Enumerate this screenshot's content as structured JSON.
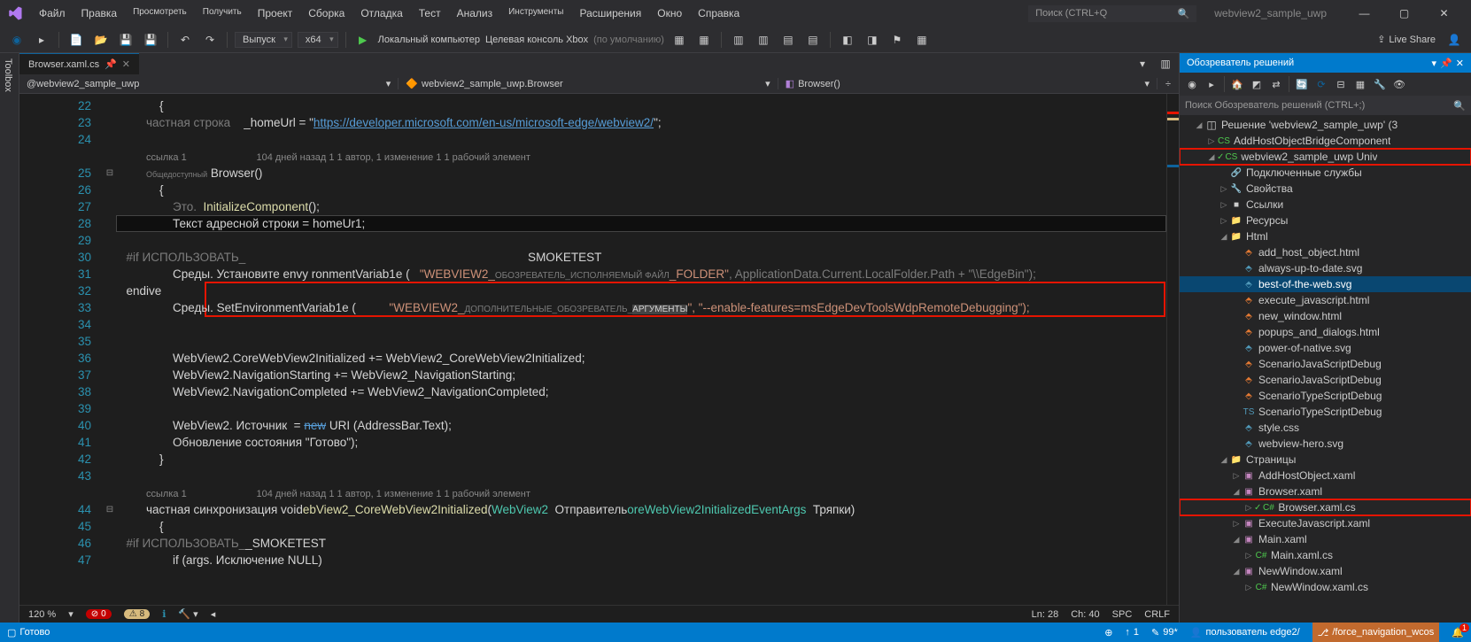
{
  "menu": [
    "Файл",
    "Правка",
    "Просмотреть",
    "Получить",
    "Проект",
    "Сборка",
    "Отладка",
    "Тест",
    "Анализ",
    "Инструменты",
    "Расширения",
    "Окно",
    "Справка"
  ],
  "menu_small_idx": [
    2,
    3,
    9
  ],
  "search_placeholder": "Поиск (CTRL+Q",
  "app_title": "webview2_sample_uwp",
  "toolbar": {
    "config": "Выпуск",
    "platform": "x64",
    "start_label": "Локальный компьютер",
    "target": "Целевая консоль Xbox",
    "target_mode": "(по умолчанию)",
    "live_share": "Live Share"
  },
  "tab": {
    "label": "Browser.xaml.cs"
  },
  "nav": {
    "scope": "@webview2_sample_uwp",
    "class": "webview2_sample_uwp.Browser",
    "member": "Browser()"
  },
  "editor_footer": {
    "zoom": "120 %",
    "errors": "0",
    "warnings": "8",
    "ln_label": "Ln:",
    "ln": "28",
    "ch_label": "Ch:",
    "ch": "40",
    "spc": "SPC",
    "crlf": "CRLF"
  },
  "codelens1": {
    "refs": "ссылка 1",
    "meta": "104 дней назад 1 1 автор, 1 изменение 1 1 рабочий элемент"
  },
  "codelens2": {
    "refs": "ссылка 1",
    "meta": "104 дней назад 1 1 автор, 1 изменение 1 1 рабочий элемент"
  },
  "lines": {
    "22": "{",
    "23_pre": "частная строка",
    "23_post": "\";",
    "23_var": "_homeUrl = \"",
    "23_url": "https://developer.microsoft.com/en-us/microsoft-edge/webview2/",
    "25_mod": "Общедоступный",
    "25_name": "Browser()",
    "26": "{",
    "27_a": "Это.",
    "27_b": "InitializeComponent",
    "27_c": "();",
    "28": "Текст адресной строки = homeUr1;",
    "30_pre": "#if",
    "30_a": "ИСПОЛЬЗОВАТЬ_",
    "30_right": "SMOKETEST",
    "31_a": "Среды. Установите envy ronmentVariab1e (",
    "31_s1": "\"WEBVIEW2_",
    "31_s1b": "ОБОЗРЕВАТЕЛЬ_ИСПОЛНЯЕМЫЙ ФАЙЛ",
    "31_s1c": "_FOLDER\"",
    "31_dim": ", ApplicationData.Current.LocalFolder.Path + \"\\\\EdgeBin\");",
    "32": "endive",
    "33_a": "Среды. SetEnvironmentVariab1e (",
    "33_s1": "\"WEBVIEW2_",
    "33_s1b": "ДОПОЛНИТЕЛЬНЫЕ_",
    "33_s1c": "ОБОЗРЕВАТЕЛЬ_",
    "33_arg": "АРГУМЕНТЫ",
    "33_s2": "\", \"--enable-features=msEdgeDevToolsWdpRemoteDebugging\");",
    "36": "WebView2.CoreWebView2Initialized += WebView2_CoreWebView2Initialized;",
    "37": "WebView2.NavigationStarting += WebView2_NavigationStarting;",
    "38": "WebView2.NavigationCompleted += WebView2_NavigationCompleted;",
    "40_a": "WebView2. Источник  = ",
    "40_new": "new",
    "40_b": " URI (AddressBar.Text);",
    "41": "Обновление состояния \"Готово\");",
    "42": "}",
    "44_a": "частная синхронизация void",
    "44_b": "ebView2_CoreWebView2Initialized",
    "44_c": "(",
    "44_t1": "WebView2",
    "44_d": "Отправитель",
    "44_t2": "oreWebView2InitializedEventArgs",
    "44_e": "Тряпки)",
    "46_pre": "#if",
    "46_a": "ИСПОЛЬЗОВАТЬ_",
    "46_b": "_SMOKETEST",
    "47": "if (args. Исключение NULL)"
  },
  "solution": {
    "title": "Обозреватель решений",
    "search_placeholder": "Поиск Обозреватель решений (CTRL+;)",
    "root": "Решение 'webview2_sample_uwp' (3",
    "items": [
      {
        "depth": 2,
        "exp": "▷",
        "ico": "CS",
        "cls": "cs-ico",
        "lbl": "AddHostObjectBridgeComponent"
      },
      {
        "depth": 2,
        "exp": "◢",
        "ico": "CS",
        "cls": "cs-ico",
        "lbl": "webview2_sample_uwp Univ",
        "hl": true,
        "check": true
      },
      {
        "depth": 3,
        "exp": "",
        "ico": "🔗",
        "cls": "",
        "lbl": "Подключенные службы"
      },
      {
        "depth": 3,
        "exp": "▷",
        "ico": "🔧",
        "cls": "",
        "lbl": "Свойства"
      },
      {
        "depth": 3,
        "exp": "▷",
        "ico": "■",
        "cls": "",
        "lbl": "Ссылки"
      },
      {
        "depth": 3,
        "exp": "▷",
        "ico": "📁",
        "cls": "fold-ico",
        "lbl": "Ресурсы"
      },
      {
        "depth": 3,
        "exp": "◢",
        "ico": "📁",
        "cls": "fold-ico",
        "lbl": "Html"
      },
      {
        "depth": 4,
        "exp": "",
        "ico": "⬘",
        "cls": "html-ico",
        "lbl": "add_host_object.html"
      },
      {
        "depth": 4,
        "exp": "",
        "ico": "⬘",
        "cls": "svg-ico",
        "lbl": "always-up-to-date.svg"
      },
      {
        "depth": 4,
        "exp": "",
        "ico": "⬘",
        "cls": "svg-ico",
        "lbl": "best-of-the-web.svg",
        "sel": true
      },
      {
        "depth": 4,
        "exp": "",
        "ico": "⬘",
        "cls": "html-ico",
        "lbl": "execute_javascript.html"
      },
      {
        "depth": 4,
        "exp": "",
        "ico": "⬘",
        "cls": "html-ico",
        "lbl": "new_window.html"
      },
      {
        "depth": 4,
        "exp": "",
        "ico": "⬘",
        "cls": "html-ico",
        "lbl": "popups_and_dialogs.html"
      },
      {
        "depth": 4,
        "exp": "",
        "ico": "⬘",
        "cls": "svg-ico",
        "lbl": "power-of-native.svg"
      },
      {
        "depth": 4,
        "exp": "",
        "ico": "⬘",
        "cls": "html-ico",
        "lbl": "ScenarioJavaScriptDebug"
      },
      {
        "depth": 4,
        "exp": "",
        "ico": "⬘",
        "cls": "html-ico",
        "lbl": "ScenarioJavaScriptDebug"
      },
      {
        "depth": 4,
        "exp": "",
        "ico": "⬘",
        "cls": "html-ico",
        "lbl": "ScenarioTypeScriptDebug"
      },
      {
        "depth": 4,
        "exp": "",
        "ico": "TS",
        "cls": "ts-ico",
        "lbl": "ScenarioTypeScriptDebug"
      },
      {
        "depth": 4,
        "exp": "",
        "ico": "⬘",
        "cls": "css-ico",
        "lbl": "style.css"
      },
      {
        "depth": 4,
        "exp": "",
        "ico": "⬘",
        "cls": "svg-ico",
        "lbl": "webview-hero.svg"
      },
      {
        "depth": 3,
        "exp": "◢",
        "ico": "📁",
        "cls": "fold-ico",
        "lbl": "Страницы"
      },
      {
        "depth": 4,
        "exp": "▷",
        "ico": "▣",
        "cls": "xaml-ico",
        "lbl": "AddHostObject.xaml"
      },
      {
        "depth": 4,
        "exp": "◢",
        "ico": "▣",
        "cls": "xaml-ico",
        "lbl": "Browser.xaml"
      },
      {
        "depth": 5,
        "exp": "▷",
        "ico": "C#",
        "cls": "cs-ico",
        "lbl": "Browser.xaml.cs",
        "hl": true,
        "check": true
      },
      {
        "depth": 4,
        "exp": "▷",
        "ico": "▣",
        "cls": "xaml-ico",
        "lbl": "ExecuteJavascript.xaml"
      },
      {
        "depth": 4,
        "exp": "◢",
        "ico": "▣",
        "cls": "xaml-ico",
        "lbl": "Main.xaml"
      },
      {
        "depth": 5,
        "exp": "▷",
        "ico": "C#",
        "cls": "cs-ico",
        "lbl": "Main.xaml.cs"
      },
      {
        "depth": 4,
        "exp": "◢",
        "ico": "▣",
        "cls": "xaml-ico",
        "lbl": "NewWindow.xaml"
      },
      {
        "depth": 5,
        "exp": "▷",
        "ico": "C#",
        "cls": "cs-ico",
        "lbl": "NewWindow.xaml.cs"
      }
    ]
  },
  "statusbar": {
    "ready": "Готово",
    "pending": "1",
    "commits": "99*",
    "user": "пользователь edge2/",
    "branch": "/force_navigation_wcos",
    "notif": "1"
  }
}
